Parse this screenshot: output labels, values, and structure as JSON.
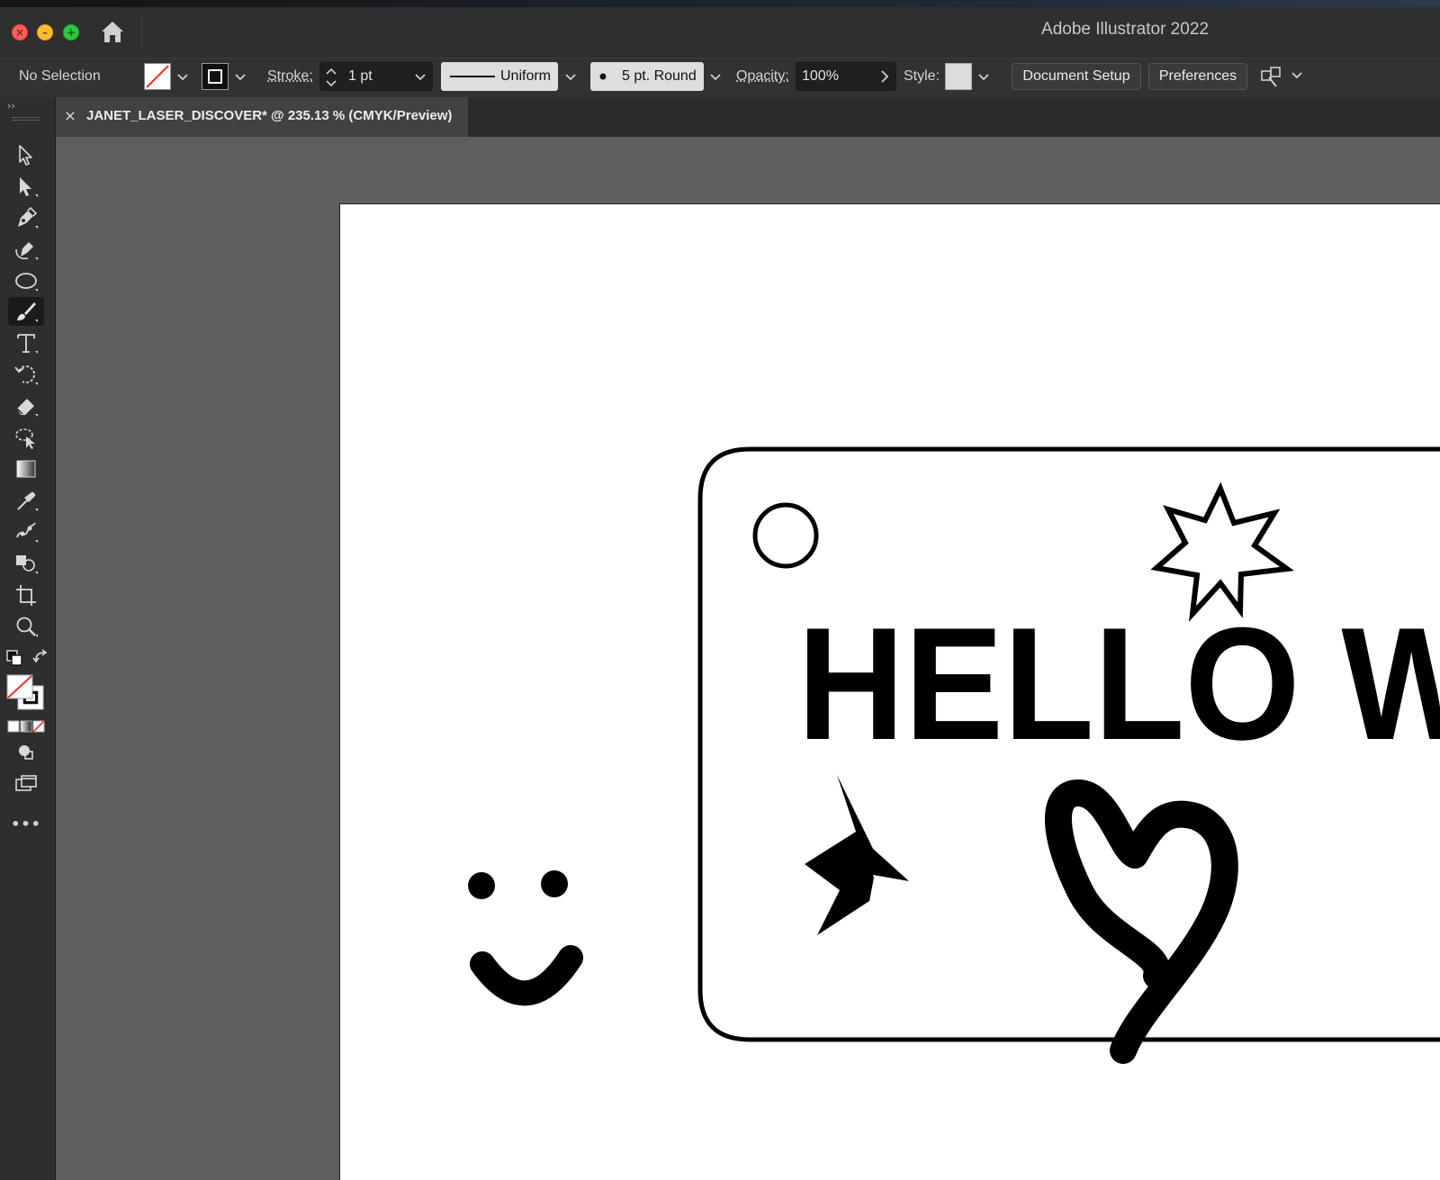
{
  "window": {
    "title": "Adobe Illustrator 2022",
    "traffic_lights": [
      "close",
      "minimize",
      "zoom"
    ],
    "traffic_glyphs": [
      "×",
      "–",
      "+"
    ]
  },
  "control_bar": {
    "selection_status": "No Selection",
    "fill": {
      "state": "none",
      "indicator_color": "#ff2a2a"
    },
    "stroke_label": "Stroke:",
    "stroke_weight": "1 pt",
    "variable_width_profile": "Uniform",
    "brush_definition": "5 pt. Round",
    "opacity_label": "Opacity:",
    "opacity_value": "100%",
    "style_label": "Style:",
    "document_setup_button": "Document Setup",
    "preferences_button": "Preferences"
  },
  "document_tab": {
    "close_glyph": "×",
    "label": "JANET_LASER_DISCOVER* @ 235.13 % (CMYK/Preview)"
  },
  "toolbar": {
    "collapse_glyph": "››",
    "more_tools_glyph": "•••",
    "tools": [
      {
        "name": "selection-tool",
        "icon": "arrow-outline"
      },
      {
        "name": "direct-selection-tool",
        "icon": "arrow-filled"
      },
      {
        "name": "pen-tool",
        "icon": "pen"
      },
      {
        "name": "curvature-tool",
        "icon": "curvature-pen"
      },
      {
        "name": "ellipse-tool",
        "icon": "ellipse"
      },
      {
        "name": "paintbrush-tool",
        "icon": "brush",
        "active": true
      },
      {
        "name": "type-tool",
        "icon": "type-T"
      },
      {
        "name": "rotate-tool",
        "icon": "rotate"
      },
      {
        "name": "eraser-tool",
        "icon": "eraser"
      },
      {
        "name": "lasso-tool",
        "icon": "lasso"
      },
      {
        "name": "gradient-tool",
        "icon": "gradient"
      },
      {
        "name": "eyedropper-tool",
        "icon": "eyedropper"
      },
      {
        "name": "puppet-warp-tool",
        "icon": "puppet-warp"
      },
      {
        "name": "shape-builder-tool",
        "icon": "shape-builder"
      },
      {
        "name": "artboard-tool",
        "icon": "artboard"
      },
      {
        "name": "zoom-tool",
        "icon": "magnifier"
      }
    ]
  },
  "artboard": {
    "tag_text": "HELLO W",
    "colors": {
      "ink": "#000000",
      "paper": "#ffffff"
    }
  }
}
